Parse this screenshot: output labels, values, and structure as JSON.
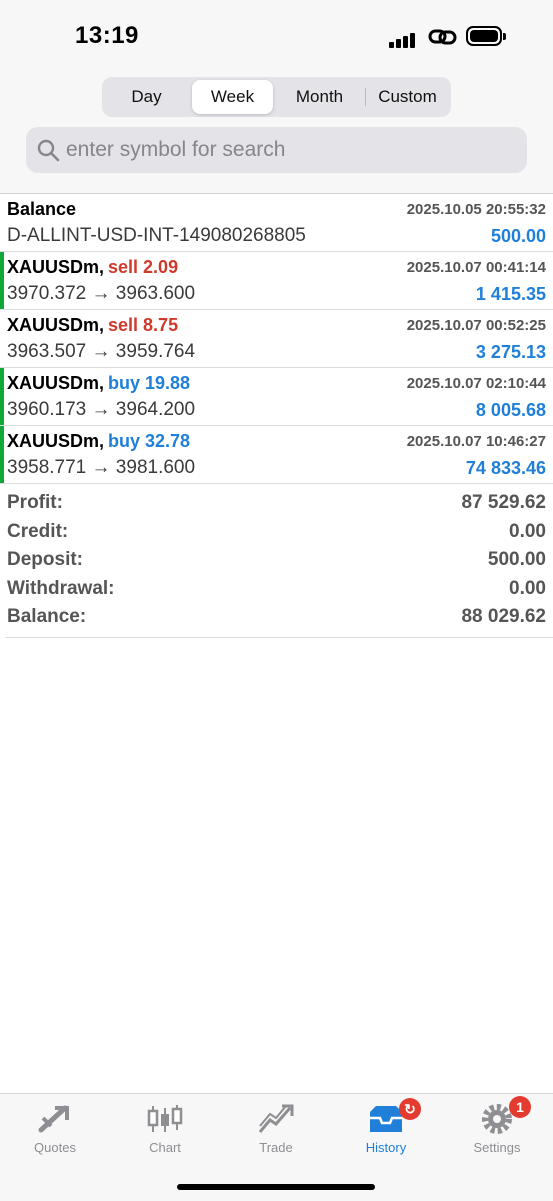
{
  "status_bar": {
    "time": "13:19"
  },
  "period_tabs": [
    {
      "label": "Day",
      "active": false
    },
    {
      "label": "Week",
      "active": true
    },
    {
      "label": "Month",
      "active": false
    },
    {
      "label": "Custom",
      "active": false
    }
  ],
  "search": {
    "placeholder": "enter symbol for search",
    "value": ""
  },
  "deals": [
    {
      "kind": "balance",
      "title": "Balance",
      "side": "",
      "date": "2025.10.05 20:55:32",
      "subtitle": "D-ALLINT-USD-INT-149080268805",
      "amount": "500.00"
    },
    {
      "kind": "trade",
      "title": "XAUUSDm,",
      "side": "sell 2.09",
      "direction": "sell",
      "date": "2025.10.07 00:41:14",
      "subtitle": "3970.372 → 3963.600",
      "amount": "1 415.35",
      "stripe": true
    },
    {
      "kind": "trade",
      "title": "XAUUSDm,",
      "side": "sell 8.75",
      "direction": "sell",
      "date": "2025.10.07 00:52:25",
      "subtitle": "3963.507 → 3959.764",
      "amount": "3 275.13",
      "stripe": false
    },
    {
      "kind": "trade",
      "title": "XAUUSDm,",
      "side": "buy 19.88",
      "direction": "buy",
      "date": "2025.10.07 02:10:44",
      "subtitle": "3960.173 → 3964.200",
      "amount": "8 005.68",
      "stripe": true
    },
    {
      "kind": "trade",
      "title": "XAUUSDm,",
      "side": "buy 32.78",
      "direction": "buy",
      "date": "2025.10.07 10:46:27",
      "subtitle": "3958.771 → 3981.600",
      "amount": "74 833.46",
      "stripe": true
    }
  ],
  "summary": [
    {
      "label": "Profit:",
      "value": "87 529.62"
    },
    {
      "label": "Credit:",
      "value": "0.00"
    },
    {
      "label": "Deposit:",
      "value": "500.00"
    },
    {
      "label": "Withdrawal:",
      "value": "0.00"
    },
    {
      "label": "Balance:",
      "value": "88 029.62"
    }
  ],
  "tabbar": {
    "quotes": "Quotes",
    "chart": "Chart",
    "trade": "Trade",
    "history": "History",
    "settings": "Settings",
    "settings_badge": "1",
    "active": "history"
  },
  "colors": {
    "accent": "#1f7fd9",
    "sell": "#d03a2a",
    "stripe": "#11a83a",
    "badge": "#e43b30"
  },
  "icons": [
    "signal-icon",
    "link-icon",
    "battery-icon",
    "search-icon",
    "quotes-icon",
    "chart-icon",
    "trade-icon",
    "history-icon",
    "settings-icon"
  ]
}
